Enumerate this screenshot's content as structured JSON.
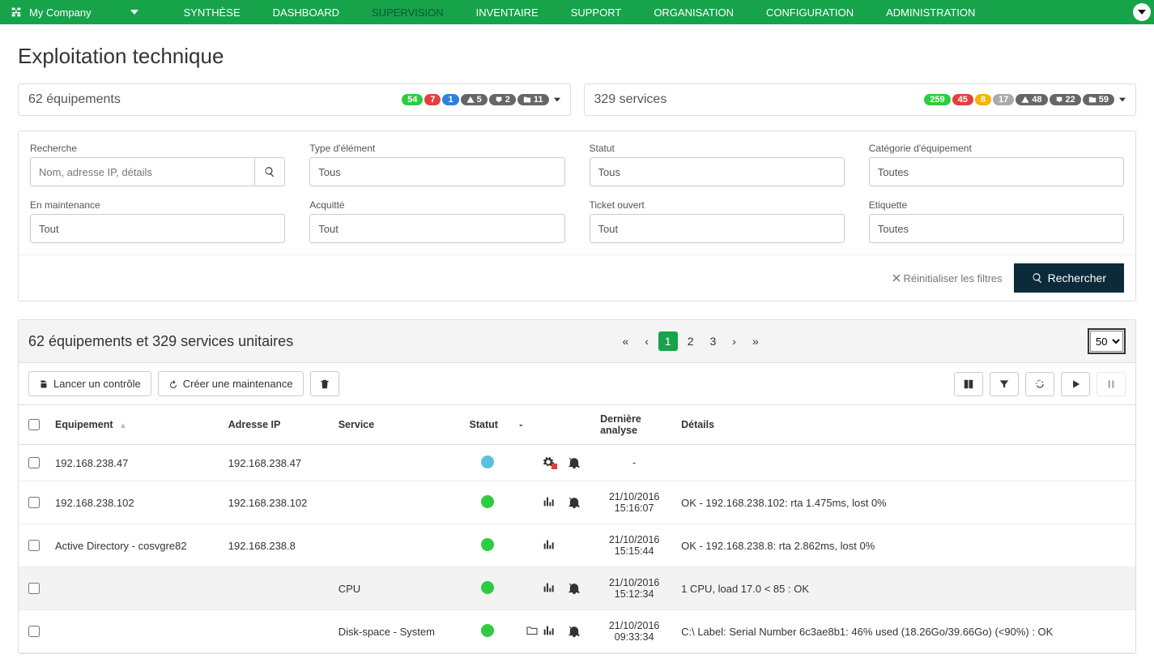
{
  "nav": {
    "company": "My Company",
    "items": [
      {
        "label": "SYNTHÈSE",
        "id": "synthese"
      },
      {
        "label": "DASHBOARD",
        "id": "dashboard"
      },
      {
        "label": "SUPERVISION",
        "id": "supervision",
        "active": true
      },
      {
        "label": "INVENTAIRE",
        "id": "inventaire"
      },
      {
        "label": "SUPPORT",
        "id": "support"
      },
      {
        "label": "ORGANISATION",
        "id": "organisation"
      },
      {
        "label": "CONFIGURATION",
        "id": "configuration"
      },
      {
        "label": "ADMINISTRATION",
        "id": "administration"
      }
    ]
  },
  "page": {
    "title": "Exploitation technique"
  },
  "summary": {
    "equip": {
      "title": "62 équipements",
      "green": "54",
      "red": "7",
      "blue": "1",
      "warn": "5",
      "ack": "2",
      "maint": "11"
    },
    "serv": {
      "title": "329 services",
      "green": "259",
      "red": "45",
      "yellow": "8",
      "gray": "17",
      "warn": "48",
      "ack": "22",
      "maint": "59"
    }
  },
  "filters": {
    "labels": {
      "recherche": "Recherche",
      "type": "Type d'élément",
      "statut": "Statut",
      "categorie": "Catégorie d'équipement",
      "maint": "En maintenance",
      "ack": "Acquitté",
      "ticket": "Ticket ouvert",
      "etiquette": "Etiquette"
    },
    "placeholder_search": "Nom, adresse IP, détails",
    "values": {
      "type": "Tous",
      "statut": "Tous",
      "categorie": "Toutes",
      "maint": "Tout",
      "ack": "Tout",
      "ticket": "Tout",
      "etiquette": "Toutes"
    },
    "reset": "Réinitialiser les filtres",
    "search": "Rechercher"
  },
  "results": {
    "title": "62 équipements et 329 services unitaires",
    "page_size": "50",
    "pagination": {
      "pages": [
        "1",
        "2",
        "3"
      ],
      "active": "1"
    },
    "toolbar": {
      "launch": "Lancer un contrôle",
      "maint": "Créer une maintenance"
    },
    "columns": {
      "equipement": "Equipement",
      "adresseip": "Adresse IP",
      "service": "Service",
      "statut": "Statut",
      "dash": "-",
      "last": "Dernière analyse",
      "details": "Détails"
    },
    "rows": [
      {
        "equip": "192.168.238.47",
        "ip": "192.168.238.47",
        "service": "",
        "status": "blue",
        "gear": true,
        "chart": false,
        "folder": false,
        "bell": true,
        "last": "-",
        "details": ""
      },
      {
        "equip": "192.168.238.102",
        "ip": "192.168.238.102",
        "service": "",
        "status": "green",
        "gear": false,
        "chart": true,
        "folder": false,
        "bell": true,
        "last": "21/10/2016 15:16:07",
        "details": "OK - 192.168.238.102: rta 1.475ms, lost 0%"
      },
      {
        "equip": "Active Directory - cosvgre82",
        "ip": "192.168.238.8",
        "service": "",
        "status": "green",
        "gear": false,
        "chart": true,
        "folder": false,
        "bell": false,
        "last": "21/10/2016 15:15:44",
        "details": "OK - 192.168.238.8: rta 2.862ms, lost 0%"
      },
      {
        "equip": "",
        "ip": "",
        "service": "CPU",
        "status": "green",
        "gear": false,
        "chart": true,
        "folder": false,
        "bell": true,
        "last": "21/10/2016 15:12:34",
        "details": "1 CPU, load 17.0 < 85 : OK"
      },
      {
        "equip": "",
        "ip": "",
        "service": "Disk-space - System",
        "status": "green",
        "gear": false,
        "chart": true,
        "folder": true,
        "bell": true,
        "last": "21/10/2016 09:33:34",
        "details": "C:\\ Label:  Serial Number 6c3ae8b1: 46% used (18.26Go/39.66Go) (<90%) : OK"
      }
    ]
  }
}
